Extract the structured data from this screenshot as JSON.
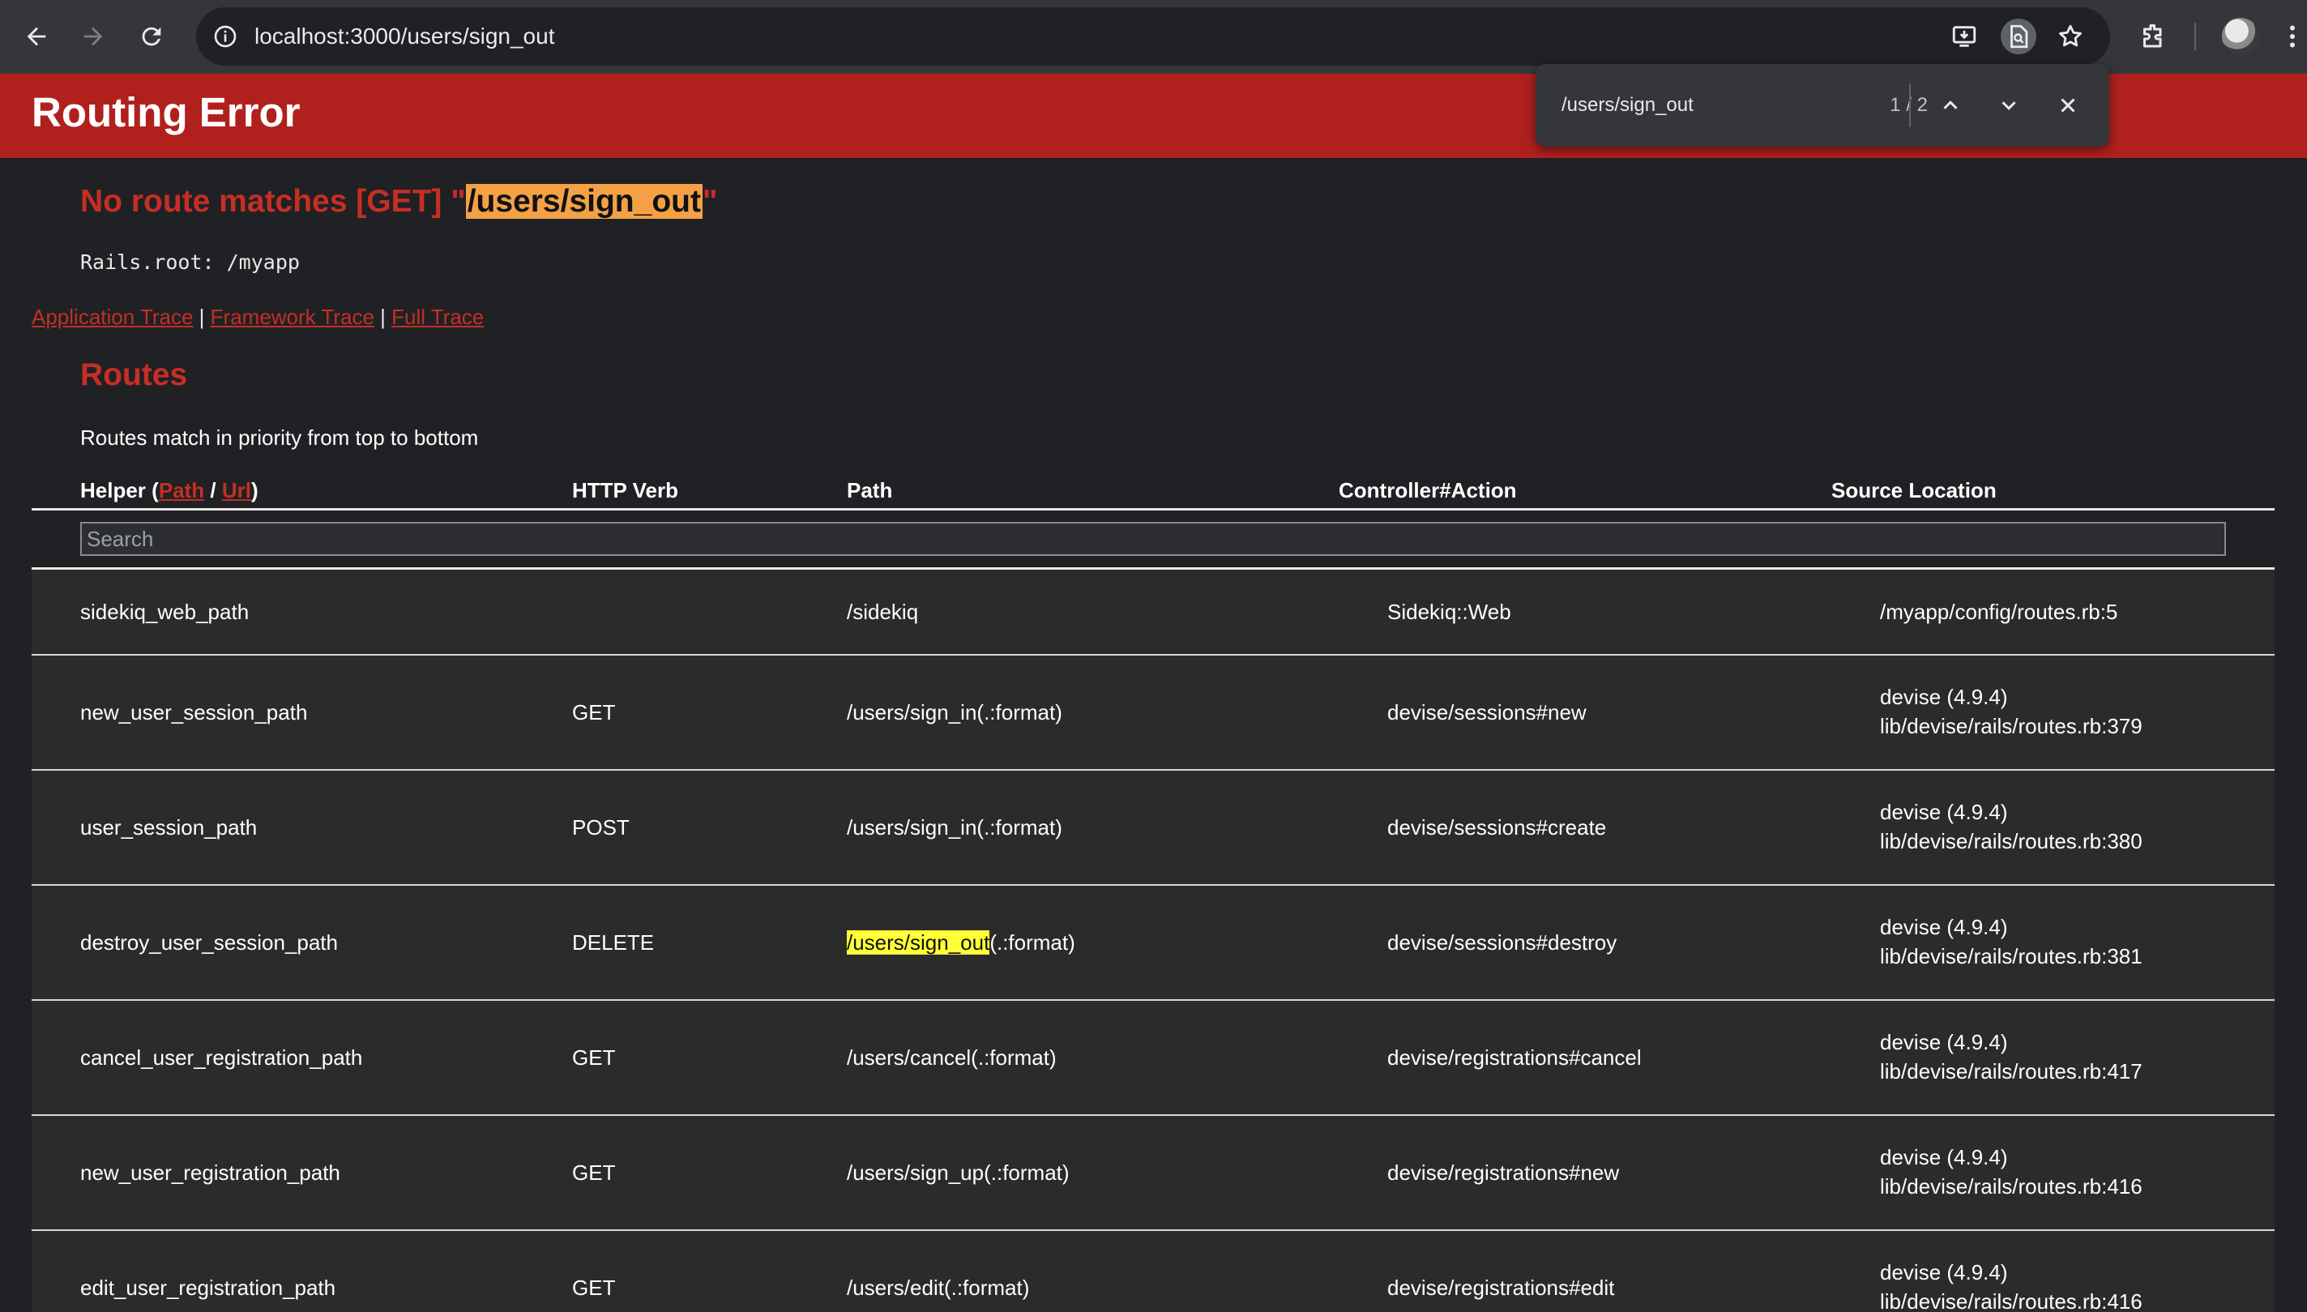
{
  "browser": {
    "url": "localhost:3000/users/sign_out",
    "icons": [
      "back-icon",
      "forward-icon",
      "reload-icon",
      "site-info-icon",
      "install-app-icon",
      "find-in-page-icon",
      "bookmark-star-icon",
      "extensions-icon",
      "profile-avatar",
      "menu-dots-icon"
    ]
  },
  "find_bar": {
    "query": "/users/sign_out",
    "count": "1 / 2"
  },
  "page": {
    "heading": "Routing Error",
    "error": {
      "prefix": "No route matches [GET] \"",
      "highlight": "/users/sign_out",
      "suffix": "\""
    },
    "rails_root": "Rails.root: /myapp",
    "trace_links": {
      "application": "Application Trace",
      "framework": "Framework Trace",
      "full": "Full Trace",
      "separator": " | "
    },
    "routes_title": "Routes",
    "routes_note": "Routes match in priority from top to bottom",
    "table_headers": {
      "helper_prefix": "Helper (",
      "helper_path": "Path",
      "helper_slash": " / ",
      "helper_url": "Url",
      "helper_suffix": ")",
      "verb": "HTTP Verb",
      "path": "Path",
      "action": "Controller#Action",
      "source": "Source Location"
    },
    "search_placeholder": "Search",
    "routes": [
      {
        "helper": "sidekiq_web_path",
        "verb": "",
        "path_hl": "",
        "path": "/sidekiq",
        "action": "Sidekiq::Web",
        "source1": "/myapp/config/routes.rb:5",
        "source2": ""
      },
      {
        "helper": "new_user_session_path",
        "verb": "GET",
        "path_hl": "",
        "path": "/users/sign_in(.:format)",
        "action": "devise/sessions#new",
        "source1": "devise (4.9.4)",
        "source2": "lib/devise/rails/routes.rb:379"
      },
      {
        "helper": "user_session_path",
        "verb": "POST",
        "path_hl": "",
        "path": "/users/sign_in(.:format)",
        "action": "devise/sessions#create",
        "source1": "devise (4.9.4)",
        "source2": "lib/devise/rails/routes.rb:380"
      },
      {
        "helper": "destroy_user_session_path",
        "verb": "DELETE",
        "path_hl": "/users/sign_out",
        "path": "(.:format)",
        "action": "devise/sessions#destroy",
        "source1": "devise (4.9.4)",
        "source2": "lib/devise/rails/routes.rb:381"
      },
      {
        "helper": "cancel_user_registration_path",
        "verb": "GET",
        "path_hl": "",
        "path": "/users/cancel(.:format)",
        "action": "devise/registrations#cancel",
        "source1": "devise (4.9.4)",
        "source2": "lib/devise/rails/routes.rb:417"
      },
      {
        "helper": "new_user_registration_path",
        "verb": "GET",
        "path_hl": "",
        "path": "/users/sign_up(.:format)",
        "action": "devise/registrations#new",
        "source1": "devise (4.9.4)",
        "source2": "lib/devise/rails/routes.rb:416"
      },
      {
        "helper": "edit_user_registration_path",
        "verb": "GET",
        "path_hl": "",
        "path": "/users/edit(.:format)",
        "action": "devise/registrations#edit",
        "source1": "devise (4.9.4)",
        "source2": "lib/devise/rails/routes.rb:416"
      }
    ]
  },
  "colors": {
    "header_red": "#b0211e",
    "title_red": "#c52f24",
    "find_highlight_active": "#f4a146",
    "find_highlight": "#ffff38"
  }
}
